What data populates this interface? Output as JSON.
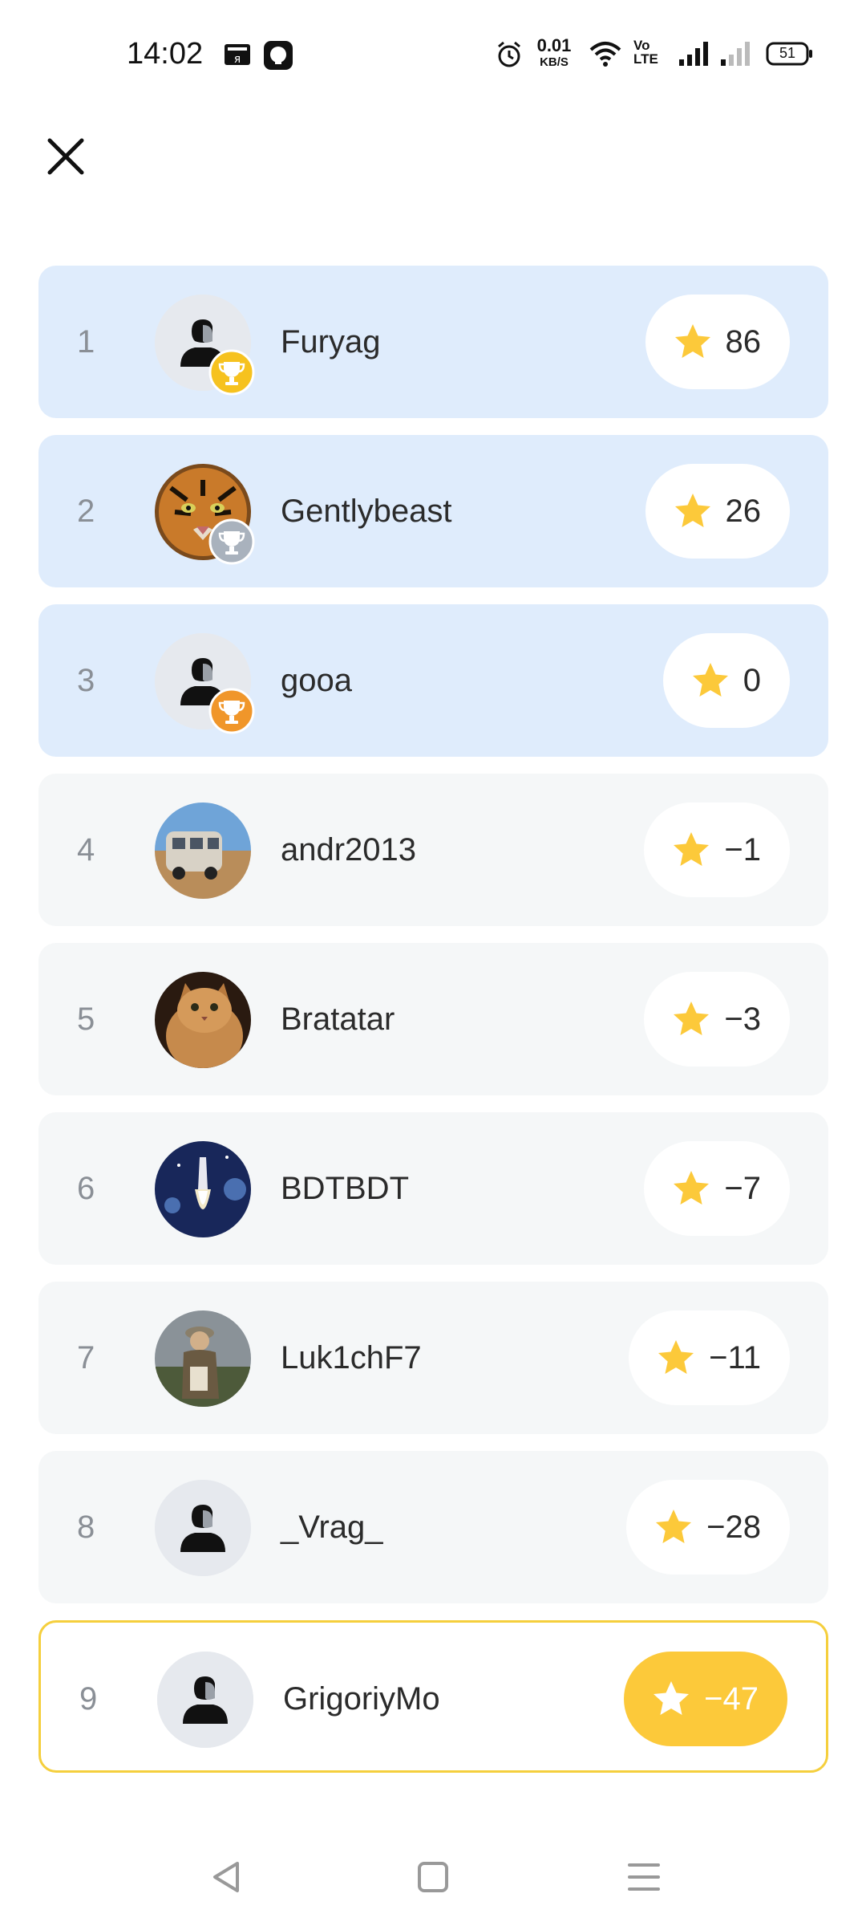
{
  "status_bar": {
    "time": "14:02",
    "net_speed_value": "0.01",
    "net_speed_unit": "KB/S",
    "volte": "Vo LTE",
    "battery": "51"
  },
  "colors": {
    "top_row_bg": "#dfecfc",
    "normal_row_bg": "#f5f7f8",
    "current_user_border": "#f5cf3d",
    "star": "#fcc93a",
    "gold": "#f6c21f",
    "silver": "#a9b2bd",
    "bronze": "#f0962a"
  },
  "leaderboard": [
    {
      "rank": "1",
      "name": "Furyag",
      "score": "86",
      "avatar": "default-avatar",
      "trophy": "gold"
    },
    {
      "rank": "2",
      "name": "Gentlybeast",
      "score": "26",
      "avatar": "tiger-photo",
      "trophy": "silver"
    },
    {
      "rank": "3",
      "name": "gooa",
      "score": "0",
      "avatar": "default-avatar",
      "trophy": "bronze"
    },
    {
      "rank": "4",
      "name": "andr2013",
      "score": "−1",
      "avatar": "van-photo"
    },
    {
      "rank": "5",
      "name": "Bratatar",
      "score": "−3",
      "avatar": "cat-photo"
    },
    {
      "rank": "6",
      "name": "BDTBDT",
      "score": "−7",
      "avatar": "rocket-photo"
    },
    {
      "rank": "7",
      "name": "Luk1chF7",
      "score": "−11",
      "avatar": "man-photo"
    },
    {
      "rank": "8",
      "name": "_Vrag_",
      "score": "−28",
      "avatar": "default-avatar"
    },
    {
      "rank": "9",
      "name": "GrigoriyMo",
      "score": "−47",
      "avatar": "default-avatar",
      "current_user": true
    }
  ]
}
